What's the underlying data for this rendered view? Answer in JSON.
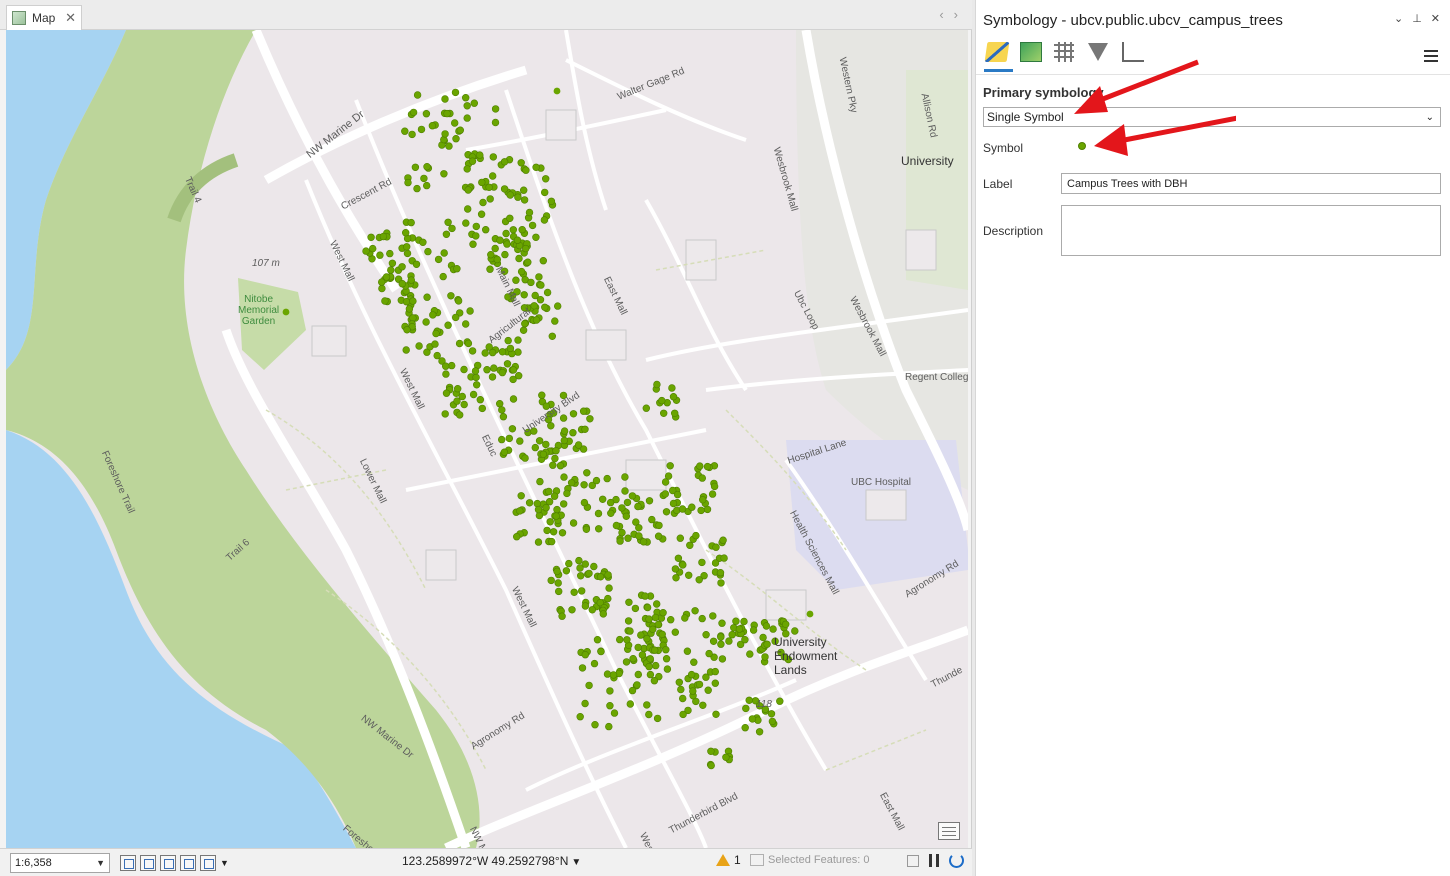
{
  "map_tab": {
    "label": "Map"
  },
  "map_labels": {
    "nw_marine_dr": "NW Marine Dr",
    "walter_gage_rd": "Walter Gage Rd",
    "western_pky": "Western Pky",
    "allison_rd": "Allison Rd",
    "university": "University",
    "crescent_rd": "Crescent Rd",
    "trail_4": "Trail 4",
    "west_mall": "West Mall",
    "main_mall": "Main Mall",
    "east_mall": "East Mall",
    "wesbrook_mall": "Wesbrook Mall",
    "ubc_loop": "Ubc Loop",
    "elev_107": "107 m",
    "nitobe": "Nitobe\nMemorial\nGarden",
    "regent_college": "Regent College",
    "hospital_lane": "Hospital Lane",
    "ubc_hospital": "UBC Hospital",
    "university_blvd": "University Blvd",
    "lower_mall": "Lower Mall",
    "foreshore_trail": "Foreshore Trail",
    "trail_6": "Trail 6",
    "health_sciences_mall": "Health Sciences Mall",
    "agronomy_rd": "Agronomy Rd",
    "university_endowment_lands": "University\nEndowment\nLands",
    "elev_118": "118",
    "thunderbird_blvd": "Thunderbird Blvd",
    "thunde": "Thunde",
    "east_mall_2": "East Mall",
    "nw_marine_dr_2": "NW Marine Dr",
    "foresho": "Foresho",
    "nw_ma": "NW Ma",
    "wes": "Wes",
    "educ": "Educ",
    "agricultural": "Agricultural",
    "west_mall_2": "West Mall",
    "westmall_3": "West Mall"
  },
  "statusbar": {
    "scale": "1:6,358",
    "coordinates": "123.2589972°W 49.2592798°N",
    "warning_count": "1",
    "selected_features": "Selected Features: 0"
  },
  "symbology": {
    "title": "Symbology - ubcv.public.ubcv_campus_trees",
    "primary_label": "Primary symbology",
    "renderer": "Single Symbol",
    "symbol_label": "Symbol",
    "label_label": "Label",
    "label_value": "Campus Trees with DBH",
    "description_label": "Description",
    "description_value": ""
  },
  "colors": {
    "tree_point": "#6aa500",
    "arrow": "#e3161b",
    "water": "#a6d3f2",
    "park": "#bcd59a"
  },
  "icons": [
    "map-tab-icon",
    "close-icon",
    "chevron-left-icon",
    "chevron-right-icon",
    "symbology-pen-icon",
    "vary-symbology-icon",
    "label-grid-icon",
    "filter-icon",
    "mask-icon",
    "menu-icon",
    "basemap-icon",
    "warning-icon",
    "pause-icon",
    "refresh-icon"
  ]
}
